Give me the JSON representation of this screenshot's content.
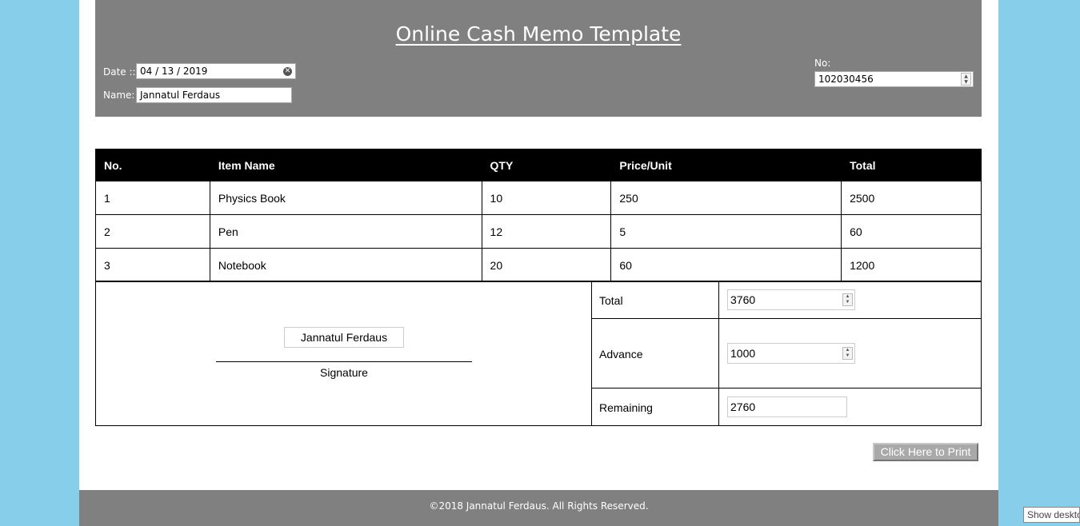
{
  "header": {
    "title": "Online Cash Memo Template",
    "date_label": "Date ::",
    "date_value": "04 / 13 / 2019",
    "name_label": "Name:",
    "name_value": "Jannatul Ferdaus",
    "no_label": "No:",
    "no_value": "102030456"
  },
  "table": {
    "columns": [
      "No.",
      "Item Name",
      "QTY",
      "Price/Unit",
      "Total"
    ],
    "rows": [
      [
        "1",
        "Physics Book",
        "10",
        "250",
        "2500"
      ],
      [
        "2",
        "Pen",
        "12",
        "5",
        "60"
      ],
      [
        "3",
        "Notebook",
        "20",
        "60",
        "1200"
      ]
    ]
  },
  "signature": {
    "name": "Jannatul Ferdaus",
    "label": "Signature"
  },
  "summary": {
    "total_label": "Total",
    "total_value": "3760",
    "advance_label": "Advance",
    "advance_value": "1000",
    "remaining_label": "Remaining",
    "remaining_value": "2760"
  },
  "print_button": "Click Here to Print",
  "footer": "©2018 Jannatul Ferdaus. All Rights Reserved.",
  "taskbar": {
    "tooltip": "Show desktop"
  }
}
